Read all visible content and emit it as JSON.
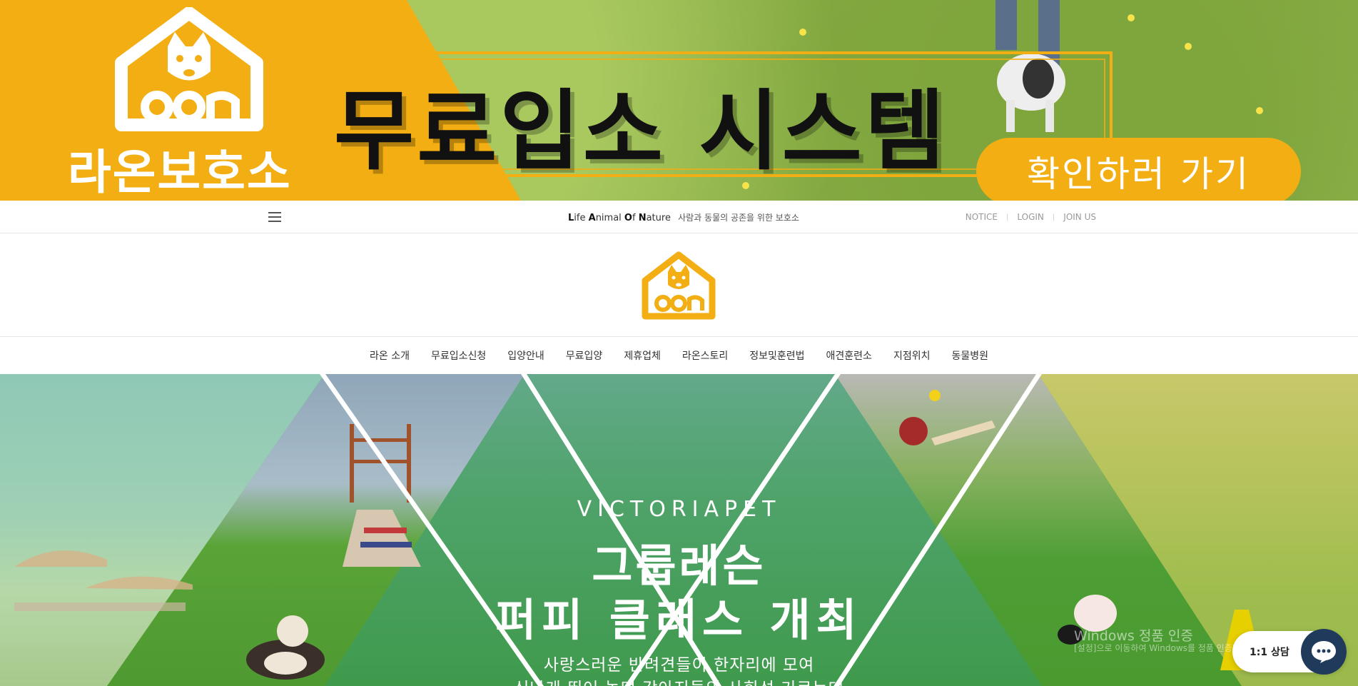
{
  "banner": {
    "shelter_name": "라온보호소",
    "headline": "무료입소 시스템",
    "cta_label": "확인하러 가기",
    "accent_color": "#f2ae12"
  },
  "topbar": {
    "menu_icon": "hamburger-icon",
    "tagline_parts": [
      "L",
      "ife ",
      "A",
      "nimal ",
      "O",
      "f ",
      "N",
      "ature"
    ],
    "tagline_kr": "사람과 동물의 공존을 위한 보호소",
    "links": [
      "NOTICE",
      "LOGIN",
      "JOIN US"
    ]
  },
  "logo": {
    "icon": "dog-house-logo-icon"
  },
  "nav": {
    "items": [
      "라온 소개",
      "무료입소신청",
      "입양안내",
      "무료입양",
      "제휴업체",
      "라온스토리",
      "정보및훈련법",
      "애견훈련소",
      "지점위치",
      "동물병원"
    ]
  },
  "hero": {
    "brand": "VICTORIAPET",
    "title_line1": "그룹레슨",
    "title_line2": "퍼피 클래스 개최",
    "sub_line1": "사랑스러운 반려견들이 한자리에 모여",
    "sub_line2": "신나게 뛰어 놀며 강아지들의 사회성 기르는데"
  },
  "os_overlay": {
    "line1": "Windows 정품 인증",
    "line2": "[설정]으로 이동하여 Windows를 정품 인증합니다."
  },
  "chat": {
    "label": "1:1 상담",
    "icon": "chat-bubble-icon",
    "button_color": "#1f3a5a"
  }
}
